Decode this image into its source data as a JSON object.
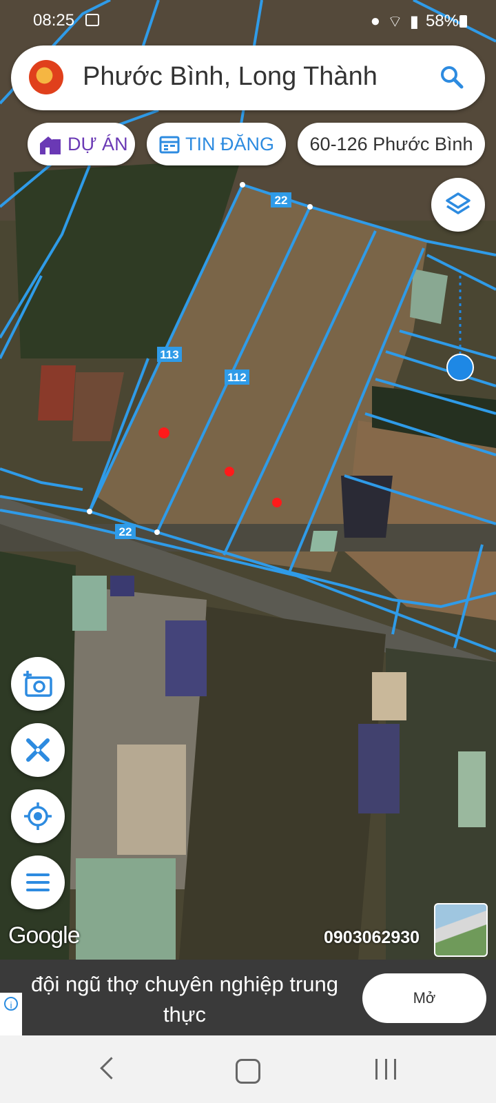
{
  "status_bar": {
    "time": "08:25",
    "battery": "58%"
  },
  "search": {
    "query": "Phước Bình, Long Thành"
  },
  "chips": {
    "du_an": "DỰ ÁN",
    "tin_dang": "TIN ĐĂNG",
    "address": "60-126 Phước Bình"
  },
  "parcels": {
    "label_113": "113",
    "label_112": "112",
    "edge_top": "22",
    "edge_bottom": "22"
  },
  "map": {
    "attribution": "Google",
    "phone": "0903062930"
  },
  "ad": {
    "text": "đội ngũ thợ chuyên nghiệp trung thực",
    "button": "Mở"
  },
  "colors": {
    "parcel_line": "#2f9be8",
    "marker": "#ff1a1a",
    "location_dot": "#1e88e5",
    "duan_purple": "#6a39b5",
    "tindang_blue": "#2d8be0"
  }
}
